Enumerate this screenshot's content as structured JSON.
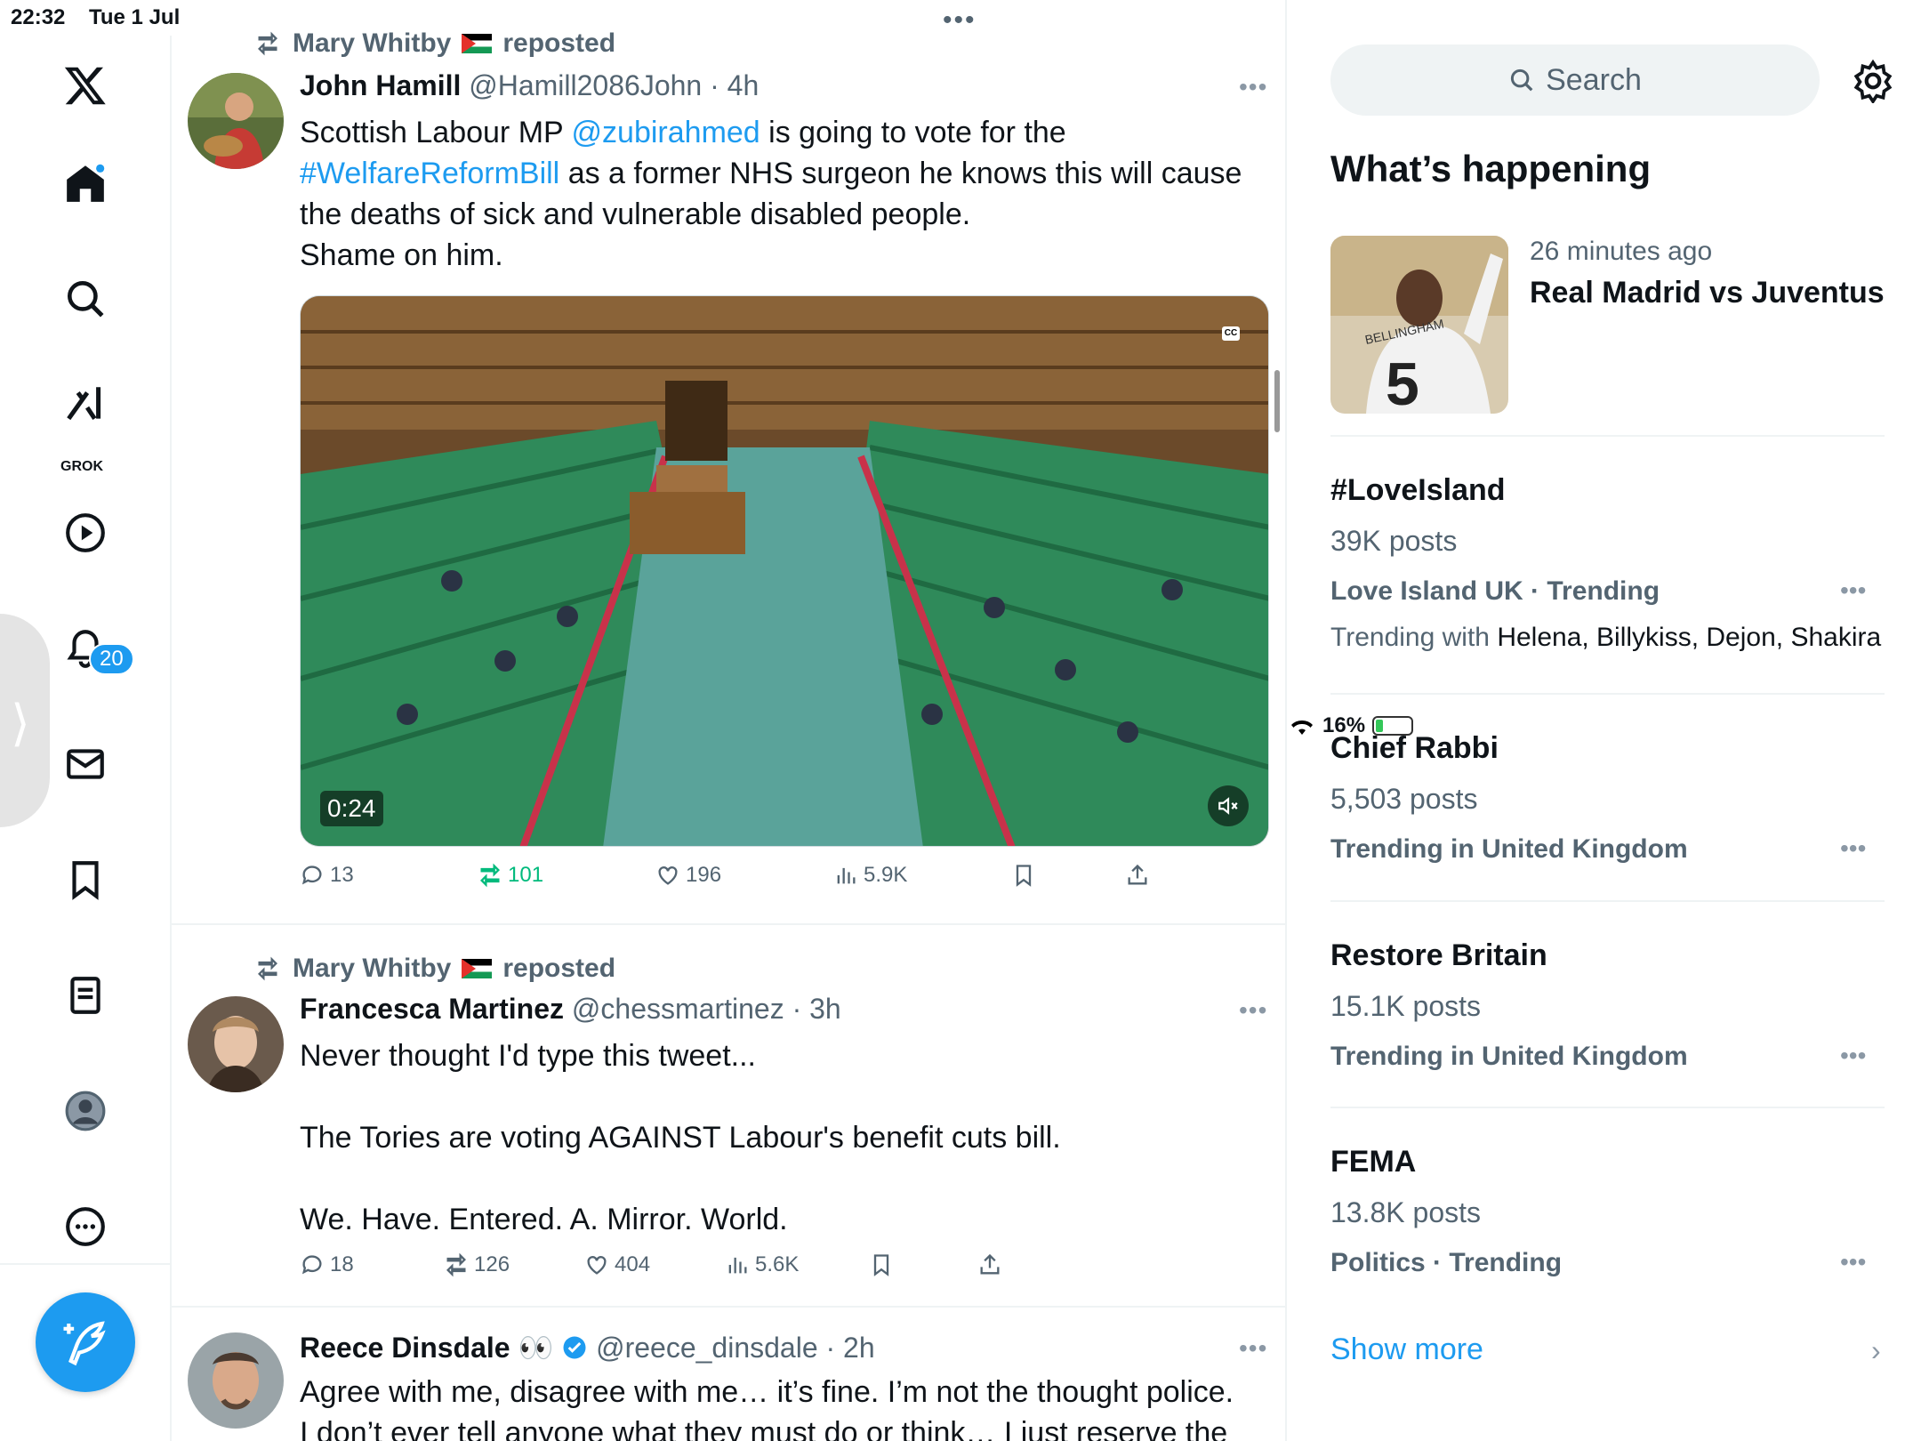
{
  "status": {
    "time": "22:32",
    "date": "Tue 1 Jul",
    "battery": "16%"
  },
  "nav": {
    "grok_label": "GROK",
    "notifications_badge": "20"
  },
  "tweets": [
    {
      "reposted_by": "Mary Whitby",
      "reposted_suffix": "reposted",
      "name": "John Hamill",
      "handle": "@Hamill2086John",
      "time": "· 4h",
      "text_a": "Scottish Labour MP ",
      "mention": "@zubirahmed",
      "text_b": " is going to vote for the",
      "hashtag": "#WelfareReformBill",
      "text_c": " as a former NHS surgeon he knows this will cause the deaths of sick and vulnerable disabled people.",
      "text_d": "Shame on him.",
      "video_duration": "0:24",
      "replies": "13",
      "reposts": "101",
      "likes": "196",
      "views": "5.9K"
    },
    {
      "reposted_by": "Mary Whitby",
      "reposted_suffix": "reposted",
      "name": "Francesca Martinez",
      "handle": "@chessmartinez",
      "time": "· 3h",
      "line1": "Never thought I'd type this tweet...",
      "line2": "The Tories are voting AGAINST Labour's benefit cuts bill.",
      "line3": "We. Have. Entered. A. Mirror. World.",
      "replies": "18",
      "reposts": "126",
      "likes": "404",
      "views": "5.6K"
    },
    {
      "name": "Reece Dinsdale",
      "name_emoji": "👀",
      "handle": "@reece_dinsdale",
      "time": "· 2h",
      "line1": "Agree with me, disagree with me… it’s fine. I’m not the thought police.",
      "line2": "I don’t ever tell anyone what they must do or think… I just reserve the"
    }
  ],
  "sidebar": {
    "search_placeholder": "Search",
    "title": "What’s happening",
    "news": {
      "time": "26 minutes ago",
      "headline": "Real Madrid vs Juventus",
      "shirt_text": "BELLINGHAM",
      "shirt_number": "5"
    },
    "trends": [
      {
        "title": "#LoveIsland",
        "posts": "39K posts",
        "meta": "Love Island UK · Trending",
        "with_label": "Trending with ",
        "with": "Helena, Billykiss, Dejon, Shakira"
      },
      {
        "title": "Chief Rabbi",
        "posts": "5,503 posts",
        "meta": "Trending in United Kingdom"
      },
      {
        "title": "Restore Britain",
        "posts": "15.1K posts",
        "meta": "Trending in United Kingdom"
      },
      {
        "title": "FEMA",
        "posts": "13.8K posts",
        "meta": "Politics · Trending"
      }
    ],
    "show_more": "Show more"
  },
  "colors": {
    "accent": "#1d9bf0",
    "repost_green": "#00ba7c",
    "muted": "#536471"
  }
}
